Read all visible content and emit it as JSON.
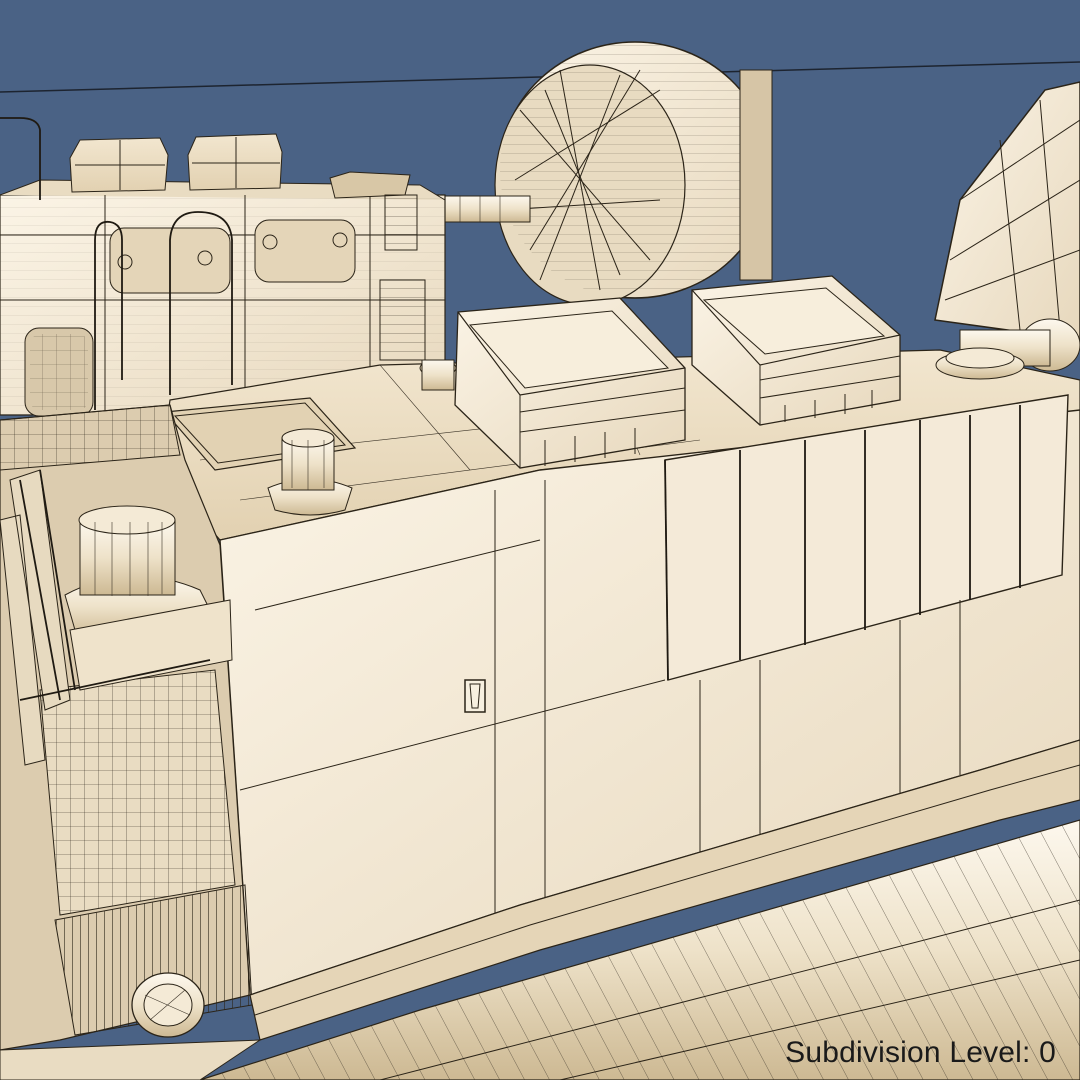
{
  "scene": {
    "caption": "Subdivision Level: 0",
    "background_color": "#4a6285",
    "model_color": "#efe4cf",
    "model_shadow_color": "#c9b89a",
    "wire_color": "#2b2418"
  }
}
